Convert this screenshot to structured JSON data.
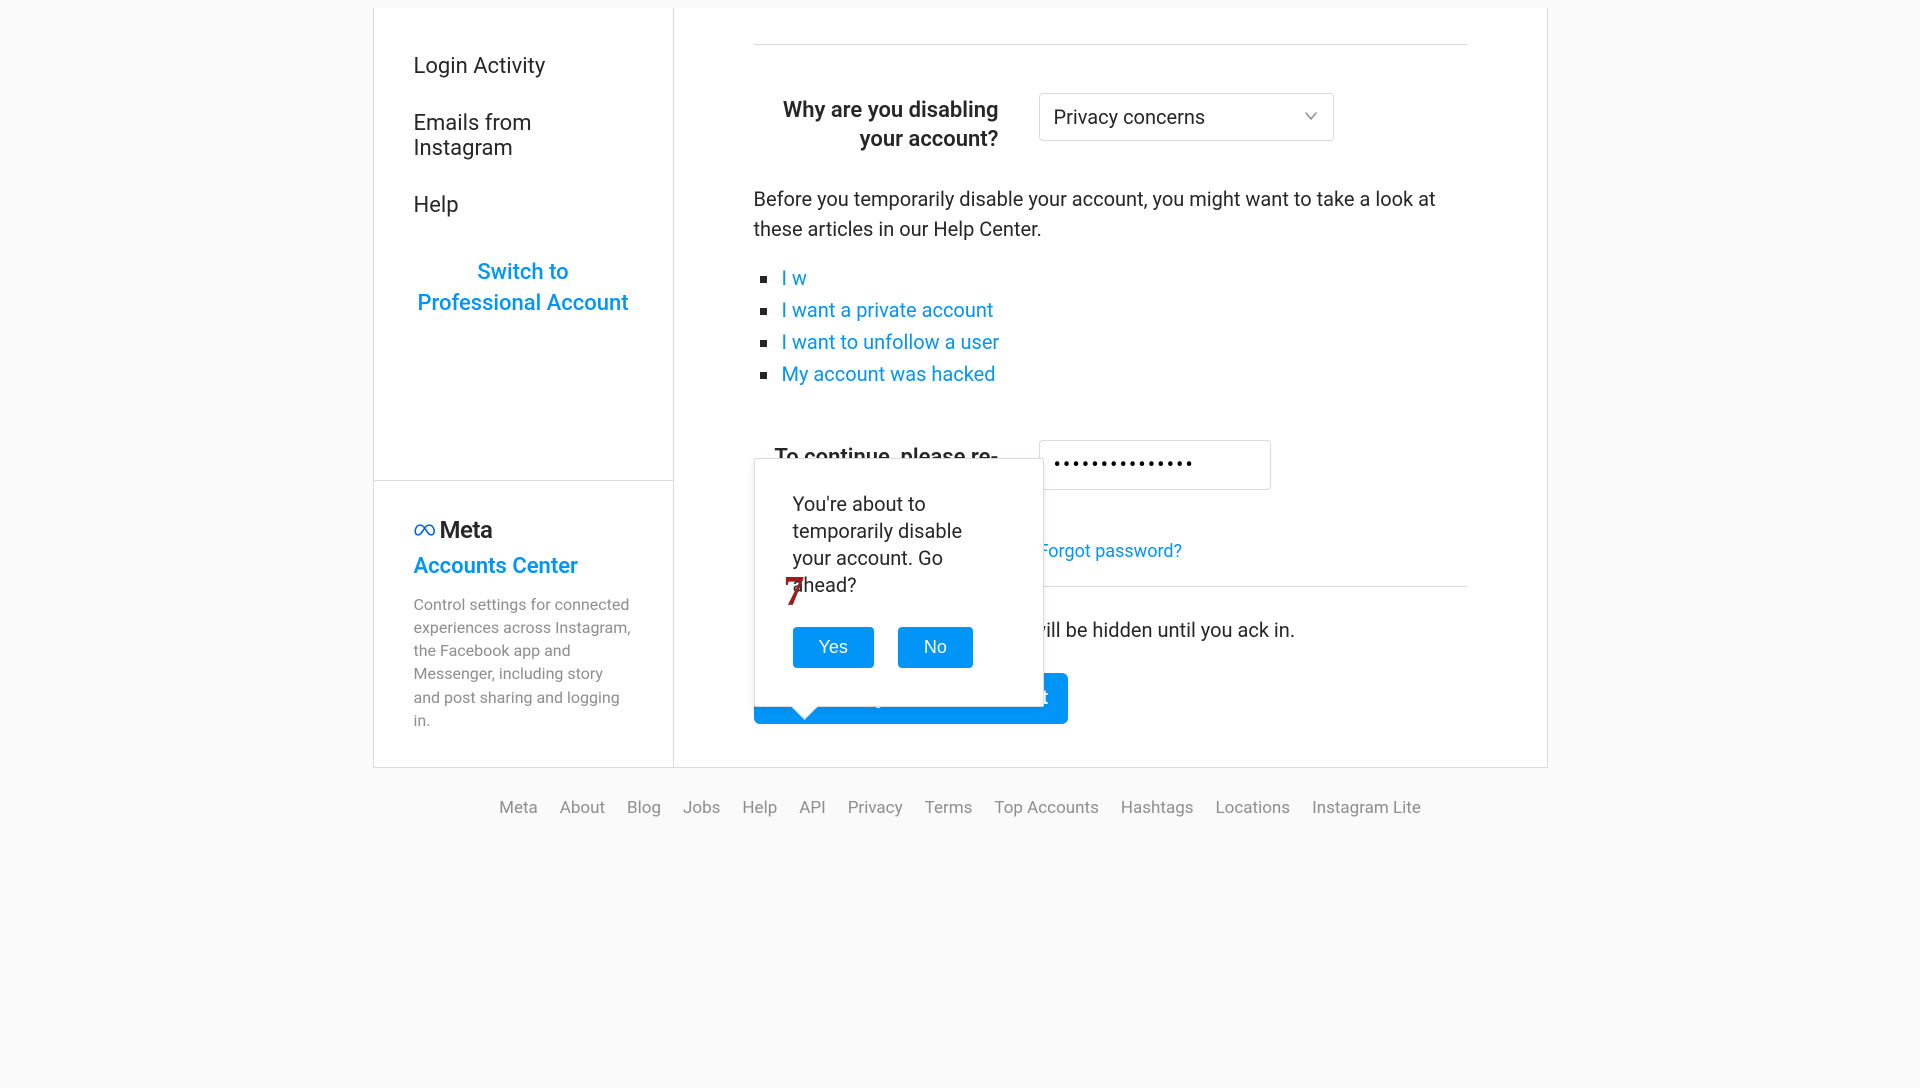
{
  "sidebar": {
    "items": [
      {
        "label": "Login Activity"
      },
      {
        "label": "Emails from Instagram"
      },
      {
        "label": "Help"
      }
    ],
    "switch_label": "Switch to Professional Account",
    "meta_brand": "Meta",
    "accounts_center_label": "Accounts Center",
    "accounts_center_desc": "Control settings for connected experiences across Instagram, the Facebook app and Messenger, including story and post sharing and logging in."
  },
  "main": {
    "reason_label": "Why are you disabling your account?",
    "reason_selected": "Privacy concerns",
    "help_intro": "Before you temporarily disable your account, you might want to take a look at these articles in our Help Center.",
    "help_links": [
      "I w",
      "I want a private account",
      "I want to unfollow a user",
      "My account was hacked"
    ],
    "password_label": "To continue, please re-enter your password",
    "password_value": "•••••••••••••••",
    "forgot_link": "Forgot password?",
    "disable_note_prefix": "ur photos, comments and likes will be hidden until you ",
    "disable_note_suffix": "ack in.",
    "disable_button": "Temporarily Disable Account"
  },
  "popover": {
    "message": "You're about to temporarily disable your account. Go ahead?",
    "yes": "Yes",
    "no": "No"
  },
  "annotation": "7",
  "footer": {
    "links": [
      "Meta",
      "About",
      "Blog",
      "Jobs",
      "Help",
      "API",
      "Privacy",
      "Terms",
      "Top Accounts",
      "Hashtags",
      "Locations",
      "Instagram Lite"
    ]
  }
}
